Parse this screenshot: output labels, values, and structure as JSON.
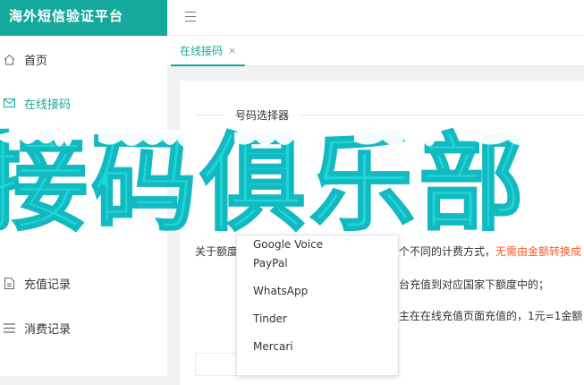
{
  "brand": {
    "title": "海外短信验证平台"
  },
  "sidebar": {
    "items": [
      {
        "label": "首页",
        "icon": "home-icon"
      },
      {
        "label": "在线接码",
        "icon": "mail-icon"
      },
      {
        "label": "充值记录",
        "icon": "document-icon"
      },
      {
        "label": "消费记录",
        "icon": "list-icon"
      }
    ]
  },
  "tabs": [
    {
      "label": "在线接码",
      "close": "×"
    }
  ],
  "panel": {
    "legend": "号码选择器"
  },
  "banner": {
    "text": "接码俱乐部",
    "color": "#1fd6d6"
  },
  "notes": {
    "line1_left": "关于额度",
    "line1_mid": "个不同的计费方式，",
    "line1_red": "无需由金额转换成",
    "line2": "台充值到对应国家下额度中的；",
    "line3": "主在在线充值页面充值的，1元=1金额"
  },
  "dropdown": {
    "options": [
      "Google Voice",
      "PayPal",
      "WhatsApp",
      "Tinder",
      "Mercari"
    ]
  },
  "colors": {
    "brand": "#14a99a",
    "highlight": "#ff5722"
  }
}
